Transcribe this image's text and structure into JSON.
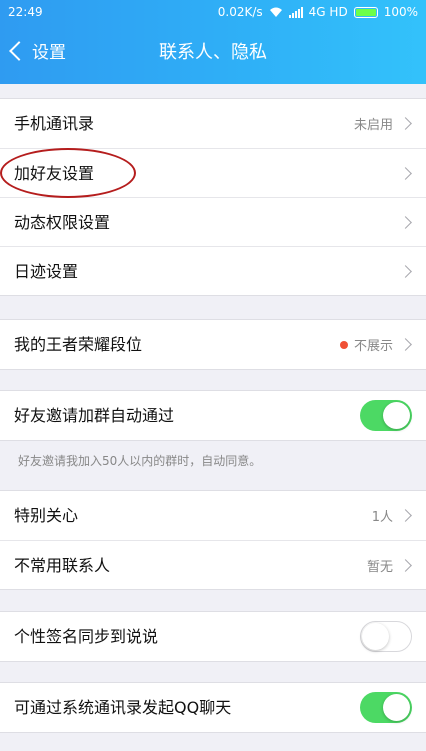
{
  "status_bar": {
    "time": "22:49",
    "speed": "0.02K/s",
    "network": "4G HD",
    "battery": "100%"
  },
  "nav": {
    "back_label": "设置",
    "title": "联系人、隐私"
  },
  "groups": [
    {
      "rows": [
        {
          "label": "手机通讯录",
          "value": "未启用",
          "type": "chevron"
        },
        {
          "label": "加好友设置",
          "value": "",
          "type": "chevron"
        },
        {
          "label": "动态权限设置",
          "value": "",
          "type": "chevron"
        },
        {
          "label": "日迹设置",
          "value": "",
          "type": "chevron"
        }
      ]
    },
    {
      "rows": [
        {
          "label": "我的王者荣耀段位",
          "value": "不展示",
          "type": "chevron",
          "dot": true
        }
      ]
    },
    {
      "rows": [
        {
          "label": "好友邀请加群自动通过",
          "type": "toggle",
          "on": true
        }
      ],
      "footnote": "好友邀请我加入50人以内的群时，自动同意。"
    },
    {
      "rows": [
        {
          "label": "特别关心",
          "value": "1人",
          "type": "chevron"
        },
        {
          "label": "不常用联系人",
          "value": "暂无",
          "type": "chevron"
        }
      ]
    },
    {
      "rows": [
        {
          "label": "个性签名同步到说说",
          "type": "toggle",
          "on": false
        }
      ]
    },
    {
      "rows": [
        {
          "label": "可通过系统通讯录发起QQ聊天",
          "type": "toggle",
          "on": true
        }
      ]
    }
  ],
  "colors": {
    "header": "#2fb1f7",
    "toggle_on": "#4cd964",
    "highlight_circle": "#b51d1d",
    "red_dot": "#f05035"
  }
}
